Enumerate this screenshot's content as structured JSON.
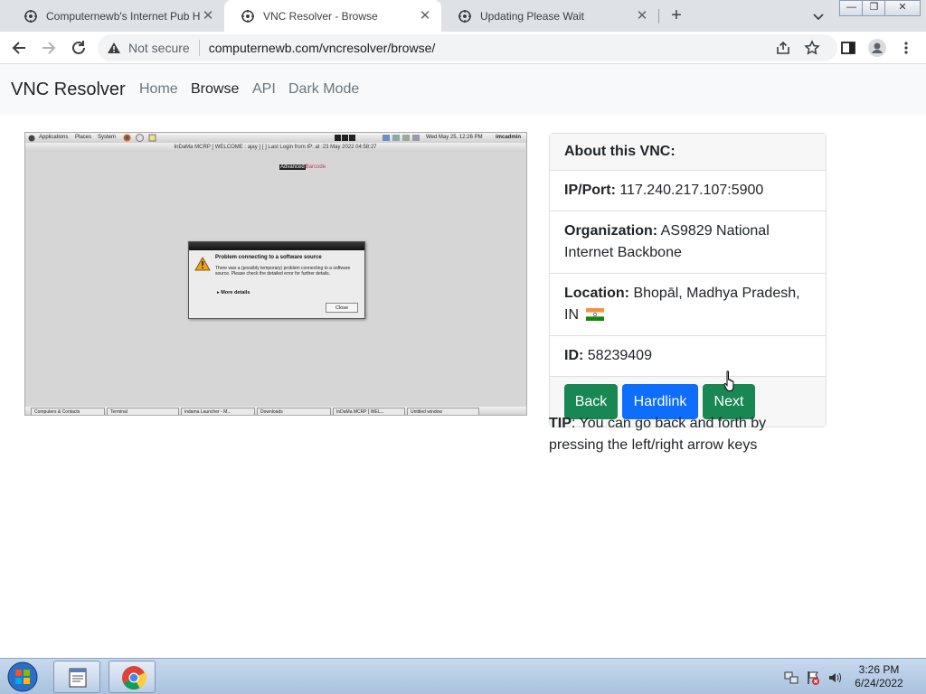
{
  "browser": {
    "tabs": [
      {
        "title": "Computernewb's Internet Pub Hub",
        "active": false
      },
      {
        "title": "VNC Resolver - Browse",
        "active": true
      },
      {
        "title": "Updating Please Wait",
        "active": false
      }
    ],
    "address": {
      "security_label": "Not secure",
      "url": "computernewb.com/vncresolver/browse/"
    }
  },
  "navbar": {
    "brand": "VNC Resolver",
    "links": [
      "Home",
      "Browse",
      "API",
      "Dark Mode"
    ],
    "active_link": "Browse"
  },
  "screenshot": {
    "top_menu": [
      "Applications",
      "Places",
      "System"
    ],
    "clock": "Wed May 25, 12:26 PM",
    "user": "imcadmin",
    "window_title": "InDaMa MCRP [ WELCOME : ajay ]    [ ] Last Login from IP: at :23 May 2022 04:58:27",
    "logo_left": "Advanced",
    "logo_right": "Barcode",
    "dialog": {
      "heading": "Problem connecting to a software source",
      "body": "There was a (possibly temporary) problem connecting to a software source. Please check the detailed error for further details.",
      "more": "More details",
      "close": "Close"
    },
    "taskbar_items": [
      "Computers & Contacts",
      "Terminal",
      "indama Launcher - M...",
      "Downloads",
      "InDaMa MCRP [ WEL...",
      "Untitled window"
    ]
  },
  "card": {
    "header": "About this VNC:",
    "ip_label": "IP/Port:",
    "ip_value": "117.240.217.107:5900",
    "org_label": "Organization:",
    "org_value": "AS9829 National Internet Backbone",
    "loc_label": "Location:",
    "loc_value": "Bhopāl, Madhya Pradesh, IN",
    "id_label": "ID:",
    "id_value": "58239409",
    "buttons": {
      "back": "Back",
      "hardlink": "Hardlink",
      "next": "Next"
    }
  },
  "tip": {
    "label": "TIP",
    "text": ": You can go back and forth by pressing the left/right arrow keys"
  },
  "os_taskbar": {
    "time": "3:26 PM",
    "date": "6/24/2022"
  },
  "colors": {
    "green_button": "#198754",
    "blue_button": "#0d6efd",
    "tabstrip": "#dee1e6",
    "navbar_bg": "#f8f9fa"
  }
}
